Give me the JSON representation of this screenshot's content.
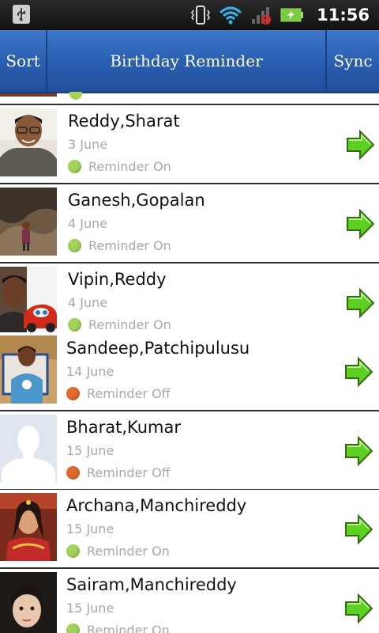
{
  "status_bar": {
    "time": "11:56",
    "icons": [
      "usb-icon",
      "vibrate-icon",
      "wifi-icon",
      "signal-no-service-icon",
      "battery-charging-icon"
    ]
  },
  "header": {
    "sort_label": "Sort",
    "title": "Birthday Reminder",
    "sync_label": "Sync",
    "color": "#2a5fb2"
  },
  "colors": {
    "reminder_on": "#a3d35a",
    "reminder_off": "#e06a2e",
    "arrow": "#5ccf21"
  },
  "contacts": [
    {
      "name": "Reddy,Sharat",
      "date": "3 June",
      "reminder": "Reminder On",
      "status": "on"
    },
    {
      "name": "Ganesh,Gopalan",
      "date": "4 June",
      "reminder": "Reminder On",
      "status": "on"
    },
    {
      "name": "Vipin,Reddy",
      "date": "4 June",
      "reminder": "Reminder On",
      "status": "on"
    },
    {
      "name": "Sandeep,Patchipulusu",
      "date": "14 June",
      "reminder": "Reminder Off",
      "status": "off"
    },
    {
      "name": "Bharat,Kumar",
      "date": "15 June",
      "reminder": "Reminder Off",
      "status": "off"
    },
    {
      "name": "Archana,Manchireddy",
      "date": "15 June",
      "reminder": "Reminder On",
      "status": "on"
    },
    {
      "name": "Sairam,Manchireddy",
      "date": "15 June",
      "reminder": "Reminder On",
      "status": "on"
    }
  ]
}
